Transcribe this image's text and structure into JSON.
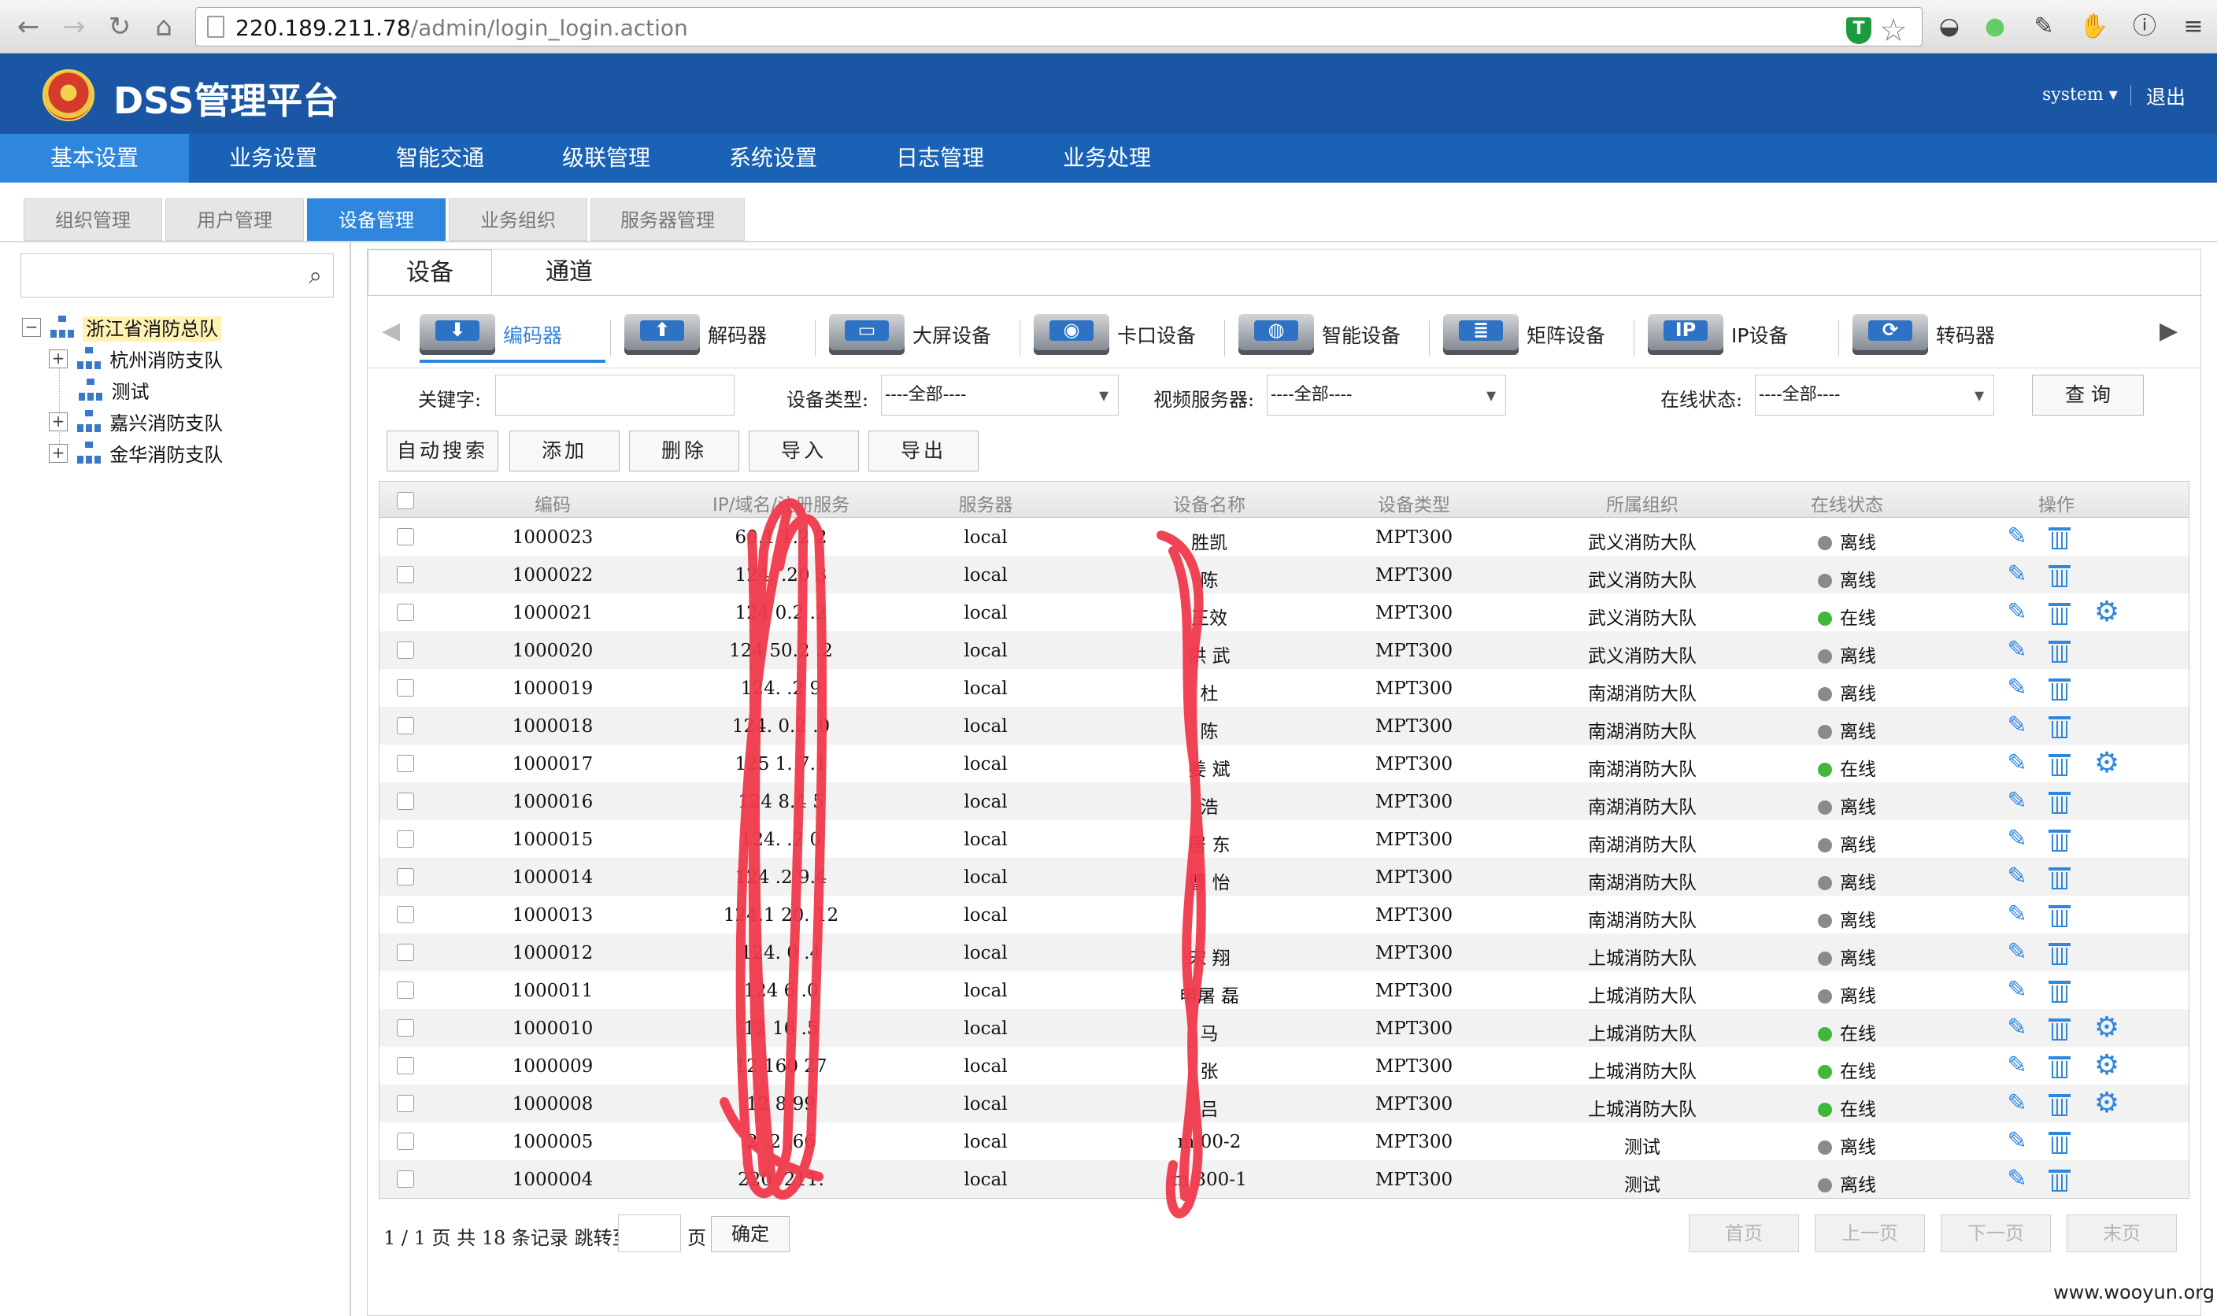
{
  "browser": {
    "url_host": "220.189.211.78",
    "url_path": "/admin/login_login.action"
  },
  "header": {
    "title": "DSS管理平台",
    "user": "system ▾",
    "logout": "退出"
  },
  "main_nav": [
    "基本设置",
    "业务设置",
    "智能交通",
    "级联管理",
    "系统设置",
    "日志管理",
    "业务处理"
  ],
  "sub_nav": [
    "组织管理",
    "用户管理",
    "设备管理",
    "业务组织",
    "服务器管理"
  ],
  "tree": {
    "root": "浙江省消防总队",
    "children": [
      "杭州消防支队",
      "测试",
      "嘉兴消防支队",
      "金华消防支队"
    ]
  },
  "content_tabs": [
    "设备",
    "通道"
  ],
  "categories": [
    {
      "label": "编码器",
      "icon": "download-arrow"
    },
    {
      "label": "解码器",
      "icon": "upload-arrow"
    },
    {
      "label": "大屏设备",
      "icon": "monitor"
    },
    {
      "label": "卡口设备",
      "icon": "camera"
    },
    {
      "label": "智能设备",
      "icon": "bulb"
    },
    {
      "label": "矩阵设备",
      "icon": "matrix"
    },
    {
      "label": "IP设备",
      "icon": "IP"
    },
    {
      "label": "转码器",
      "icon": "refresh"
    }
  ],
  "filters": {
    "keyword_label": "关键字:",
    "keyword_value": "",
    "type_label": "设备类型:",
    "type_value": "----全部----",
    "server_label": "视频服务器:",
    "server_value": "----全部----",
    "status_label": "在线状态:",
    "status_value": "----全部----",
    "query": "查 询"
  },
  "actions": [
    "自动搜索",
    "添加",
    "删除",
    "导入",
    "导出"
  ],
  "table": {
    "headers": [
      "编码",
      "IP/域名/注册服务",
      "服务器",
      "设备名称",
      "设备类型",
      "所属组织",
      "在线状态",
      "操作"
    ],
    "rows": [
      {
        "code": "1000023",
        "ip": "60.1  1.2  2",
        "server": "local",
        "name": "  胜凯",
        "type": "MPT300",
        "org": "武义消防大队",
        "status": "离线",
        "online": false
      },
      {
        "code": "1000022",
        "ip": "124.  .20  3",
        "server": "local",
        "name": "陈  ",
        "type": "MPT300",
        "org": "武义消防大队",
        "status": "离线",
        "online": false
      },
      {
        "code": "1000021",
        "ip": "124  0.2  .2",
        "server": "local",
        "name": "王效  ",
        "type": "MPT300",
        "org": "武义消防大队",
        "status": "在线",
        "online": true
      },
      {
        "code": "1000020",
        "ip": "124  50.2  .2",
        "server": "local",
        "name": "洪  武",
        "type": "MPT300",
        "org": "武义消防大队",
        "status": "离线",
        "online": false
      },
      {
        "code": "1000019",
        "ip": "124.  .2  9",
        "server": "local",
        "name": "杜  ",
        "type": "MPT300",
        "org": "南湖消防大队",
        "status": "离线",
        "online": false
      },
      {
        "code": "1000018",
        "ip": "124.  0.2  .0",
        "server": "local",
        "name": "陈  ",
        "type": "MPT300",
        "org": "南湖消防大队",
        "status": "离线",
        "online": false
      },
      {
        "code": "1000017",
        "ip": "125  1.  7.1",
        "server": "local",
        "name": "姜  斌",
        "type": "MPT300",
        "org": "南湖消防大队",
        "status": "在线",
        "online": true
      },
      {
        "code": "1000016",
        "ip": "124  8.4  5",
        "server": "local",
        "name": "  浩",
        "type": "MPT300",
        "org": "南湖消防大队",
        "status": "离线",
        "online": false
      },
      {
        "code": "1000015",
        "ip": "124.  .2  0",
        "server": "local",
        "name": "居  东",
        "type": "MPT300",
        "org": "南湖消防大队",
        "status": "离线",
        "online": false
      },
      {
        "code": "1000014",
        "ip": "124  .2  9.4",
        "server": "local",
        "name": "曹  怡",
        "type": "MPT300",
        "org": "南湖消防大队",
        "status": "离线",
        "online": false
      },
      {
        "code": "1000013",
        "ip": "124.1  20.  12",
        "server": "local",
        "name": "  ",
        "type": "MPT300",
        "org": "南湖消防大队",
        "status": "离线",
        "online": false
      },
      {
        "code": "1000012",
        "ip": "124.  0  .4",
        "server": "local",
        "name": "宋  翔",
        "type": "MPT300",
        "org": "上城消防大队",
        "status": "离线",
        "online": false
      },
      {
        "code": "1000011",
        "ip": "124  6  .0",
        "server": "local",
        "name": "申屠  磊",
        "type": "MPT300",
        "org": "上城消防大队",
        "status": "离线",
        "online": false
      },
      {
        "code": "1000010",
        "ip": "12  16  .5",
        "server": "local",
        "name": "马  ",
        "type": "MPT300",
        "org": "上城消防大队",
        "status": "在线",
        "online": true
      },
      {
        "code": "1000009",
        "ip": "12  160  27",
        "server": "local",
        "name": "张  ",
        "type": "MPT300",
        "org": "上城消防大队",
        "status": "在线",
        "online": true
      },
      {
        "code": "1000008",
        "ip": "12  8  99",
        "server": "local",
        "name": "吕  ",
        "type": "MPT300",
        "org": "上城消防大队",
        "status": "在线",
        "online": true
      },
      {
        "code": "1000005",
        "ip": "2  .2  .66",
        "server": "local",
        "name": "m  00-2",
        "type": "MPT300",
        "org": "测试",
        "status": "离线",
        "online": false
      },
      {
        "code": "1000004",
        "ip": "220.  211.  ",
        "server": "local",
        "name": "m  300-1",
        "type": "MPT300",
        "org": "测试",
        "status": "离线",
        "online": false
      }
    ]
  },
  "pager": {
    "summary": "1 / 1 页 共 18 条记录 跳转至",
    "page_suffix": "页",
    "go": "确定",
    "first": "首页",
    "prev": "上一页",
    "next": "下一页",
    "last": "末页"
  },
  "watermark": "www.wooyun.org",
  "colors": {
    "header_blue": "#1b56a5",
    "nav_blue": "#1a62b5",
    "active_blue": "#2f86dd",
    "online_green": "#3fb73a",
    "offline_gray": "#8a8a8a",
    "redaction_red": "#f0394a"
  }
}
